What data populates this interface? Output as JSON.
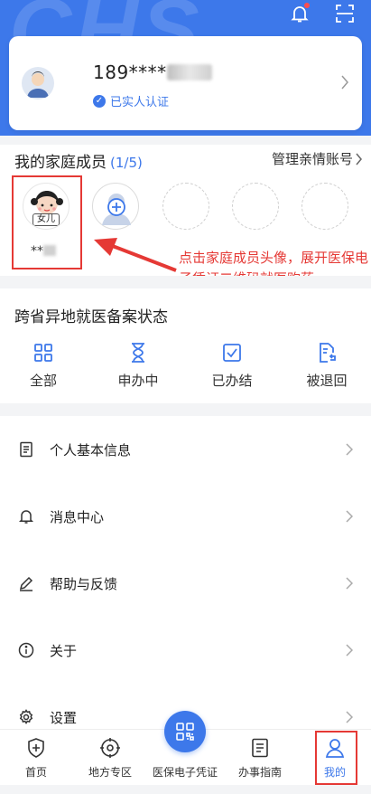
{
  "header": {
    "watermark": "CHS",
    "accent": "#3d78ea"
  },
  "profile": {
    "phone": "189****",
    "verified_label": "已实人认证",
    "avatar_icon": "user-avatar-icon"
  },
  "family": {
    "title": "我的家庭成员",
    "count": "(1/5)",
    "manage_label": "管理亲情账号",
    "members": [
      {
        "tag": "女儿",
        "name": "**"
      }
    ],
    "annotation": "点击家庭成员头像，展开医保电子凭证二维码就医购药"
  },
  "record": {
    "title": "跨省异地就医备案状态",
    "statuses": [
      {
        "label": "全部",
        "icon": "grid-icon"
      },
      {
        "label": "申办中",
        "icon": "hourglass-icon"
      },
      {
        "label": "已办结",
        "icon": "checkbox-icon"
      },
      {
        "label": "被退回",
        "icon": "return-doc-icon"
      }
    ]
  },
  "menu": [
    {
      "label": "个人基本信息",
      "icon": "document-icon"
    },
    {
      "label": "消息中心",
      "icon": "bell-icon"
    },
    {
      "label": "帮助与反馈",
      "icon": "pen-icon"
    },
    {
      "label": "关于",
      "icon": "info-icon"
    },
    {
      "label": "设置",
      "icon": "gear-icon"
    }
  ],
  "tabs": [
    {
      "label": "首页",
      "icon": "home-shield-icon"
    },
    {
      "label": "地方专区",
      "icon": "target-icon"
    },
    {
      "label": "医保电子凭证",
      "icon": "qr-code-icon"
    },
    {
      "label": "办事指南",
      "icon": "guide-doc-icon"
    },
    {
      "label": "我的",
      "icon": "person-icon"
    }
  ],
  "colors": {
    "annotation_red": "#e53935",
    "active_tab": "#3d78ea"
  }
}
